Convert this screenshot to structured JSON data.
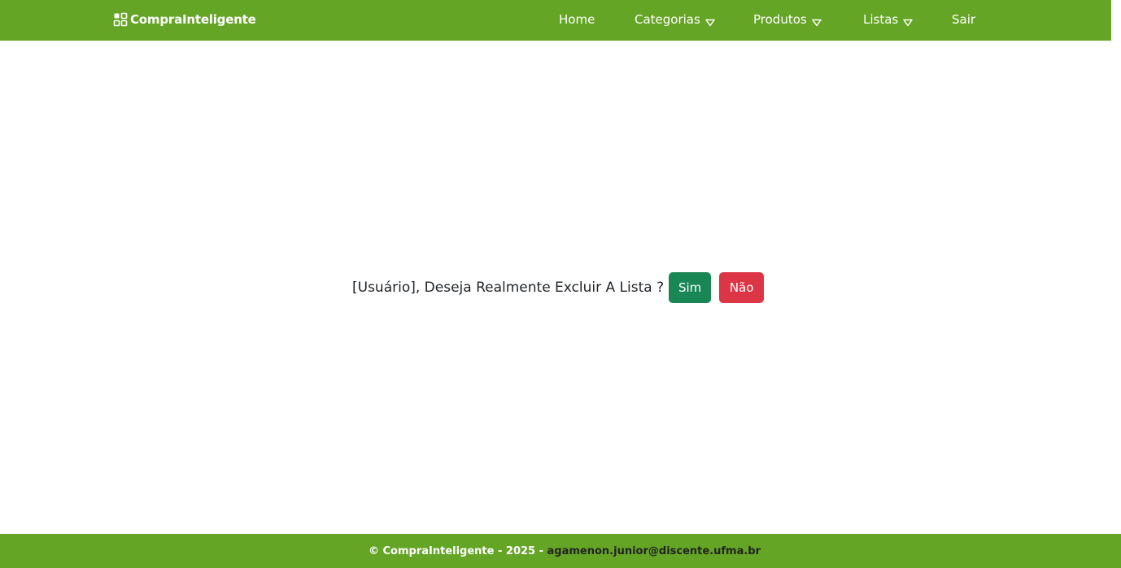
{
  "navbar": {
    "brand_label": "CompraInteligente",
    "brand_icon": "grid-icon",
    "items": [
      {
        "label": "Home",
        "has_dropdown": false
      },
      {
        "label": "Categorias",
        "has_dropdown": true
      },
      {
        "label": "Produtos",
        "has_dropdown": true
      },
      {
        "label": "Listas",
        "has_dropdown": true
      },
      {
        "label": "Sair",
        "has_dropdown": false
      }
    ]
  },
  "dialog": {
    "question": "[Usuário], Deseja Realmente Excluir A Lista ?",
    "yes_label": "Sim",
    "no_label": "Não"
  },
  "footer": {
    "text": "© CompraInteligente - 2025 - ",
    "email": "agamenon.junior@discente.ufma.br"
  },
  "colors": {
    "navbar_bg": "#65a526",
    "footer_bg": "#65a526",
    "yes_button": "#198754",
    "no_button": "#dc3545"
  }
}
